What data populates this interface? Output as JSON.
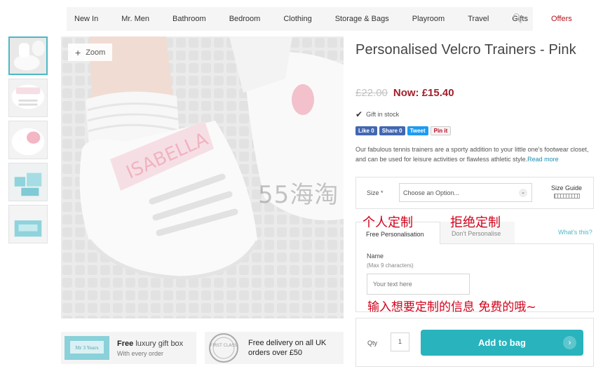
{
  "nav": {
    "items": [
      "New In",
      "Mr. Men",
      "Bathroom",
      "Bedroom",
      "Clothing",
      "Storage & Bags",
      "Playroom",
      "Travel",
      "Gifts",
      "Offers"
    ],
    "search_icon": "search-icon"
  },
  "gallery": {
    "zoom_label": "Zoom",
    "shoe_text": "ISABELLA"
  },
  "promos": {
    "gift_box_title_bold": "Free",
    "gift_box_title_rest": "luxury gift box",
    "gift_box_sub": "With every order",
    "gift_box_logo": "Mr 3 Years",
    "delivery_line1": "Free delivery on all UK",
    "delivery_line2": "orders over £50",
    "stamp_text": "FIRST CLASS"
  },
  "product": {
    "title": "Personalised Velcro Trainers - Pink",
    "old_price": "£22.00",
    "now_price": "Now: £15.40",
    "stock": "Gift in stock",
    "description": "Our fabulous tennis trainers are a sporty addition to your little one's footwear closet, and can be used for leisure activities or flawless athletic style.",
    "read_more": "Read more"
  },
  "social": {
    "like": "Like 0",
    "share": "Share 0",
    "tweet": "Tweet",
    "pin": "Pin it"
  },
  "size": {
    "label": "Size *",
    "placeholder": "Choose an Option...",
    "guide": "Size Guide"
  },
  "personalisation": {
    "tab_free": "Free Personalisation",
    "tab_dont": "Don't Personalise",
    "whats_this": "What's this?",
    "name_label": "Name",
    "name_hint": "(Max 9 characters)",
    "name_placeholder": "Your text here"
  },
  "cart": {
    "qty_label": "Qty",
    "qty_value": "1",
    "add_label": "Add to bag"
  },
  "annotations": {
    "a1": "个人定制",
    "a2": "拒绝定制",
    "a3": "输入想要定制的信息 免费的哦~"
  },
  "watermark": "55海淘",
  "colors": {
    "accent": "#29b3bd",
    "price": "#a31f2b",
    "offers": "#b5121b",
    "annotation": "#d0021b"
  }
}
